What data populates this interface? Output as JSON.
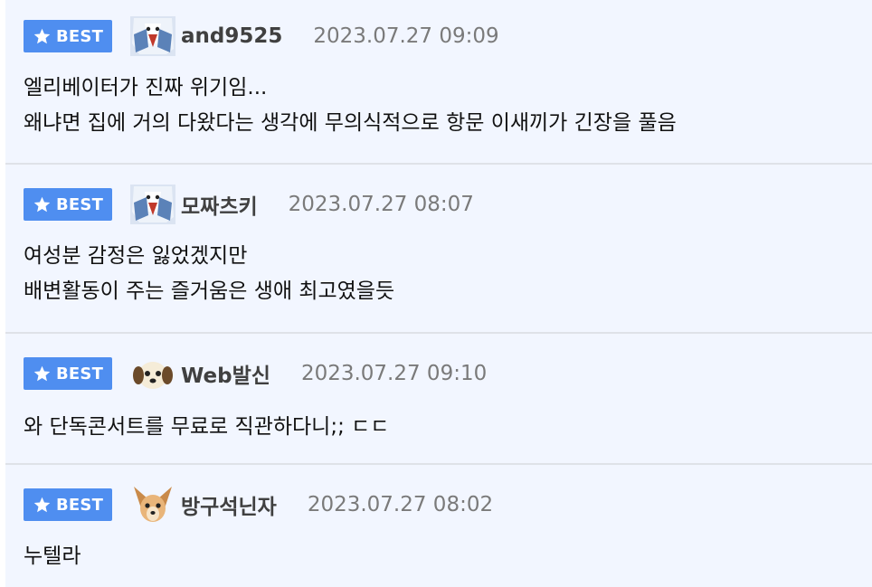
{
  "comments": [
    {
      "badge": "BEST",
      "avatar_icon": "bird-avatar-icon",
      "nick": "and9525",
      "date": "2023.07.27 09:09",
      "lines": [
        "엘리베이터가 진짜 위기임...",
        "왜냐면 집에 거의 다왔다는 생각에 무의식적으로 항문 이새끼가 긴장을 풀음"
      ]
    },
    {
      "badge": "BEST",
      "avatar_icon": "bird-avatar-icon",
      "nick": "모짜츠키",
      "date": "2023.07.27 08:07",
      "lines": [
        "여성분 감정은 잃었겠지만",
        "배변활동이 주는 즐거움은 생애 최고였을듯"
      ]
    },
    {
      "badge": "BEST",
      "avatar_icon": "puppy-avatar-icon",
      "nick": "Web발신",
      "date": "2023.07.27 09:10",
      "lines": [
        "와 단독콘서트를 무료로 직관하다니;; ㄷㄷ"
      ]
    },
    {
      "badge": "BEST",
      "avatar_icon": "chihuahua-avatar-icon",
      "nick": "방구석닌자",
      "date": "2023.07.27 08:02",
      "lines": [
        "누텔라"
      ]
    }
  ]
}
